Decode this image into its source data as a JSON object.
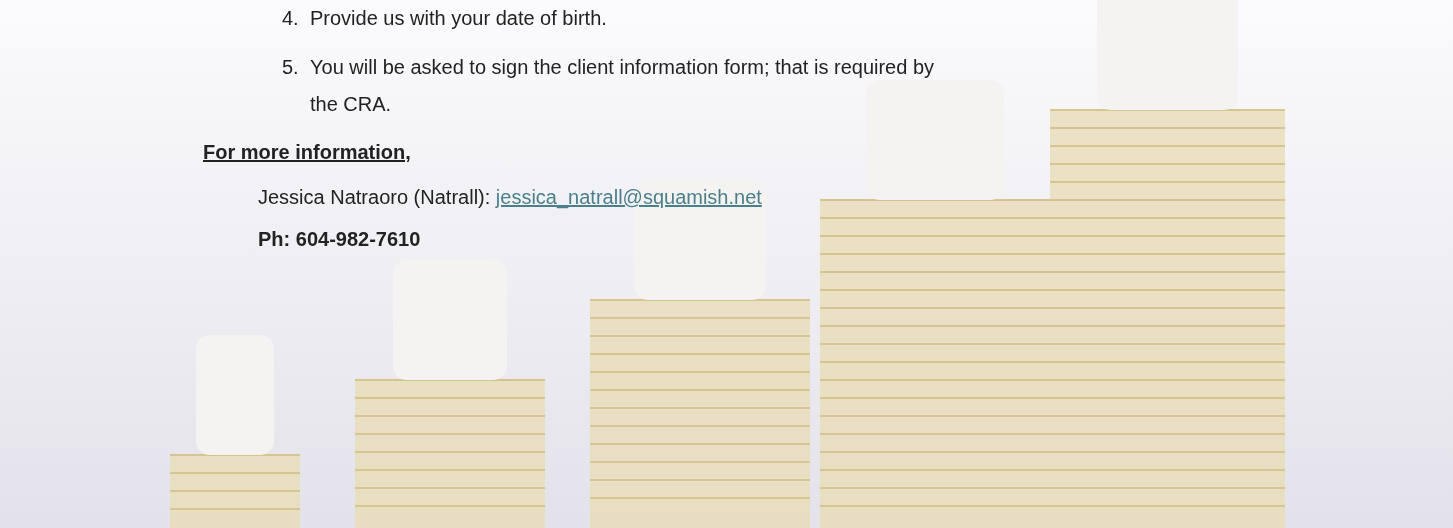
{
  "steps": [
    {
      "number": "4.",
      "text": "Provide us with your date of birth."
    },
    {
      "number": "5.",
      "text": "You will be asked to sign the client information form; that is required by the CRA."
    }
  ],
  "more_info": {
    "heading": "For more information,",
    "contact": {
      "name": "Jessica Natraoro (Natrall):",
      "email": "jessica_natrall@squamish.net"
    },
    "phone": "Ph: 604-982-7610"
  }
}
